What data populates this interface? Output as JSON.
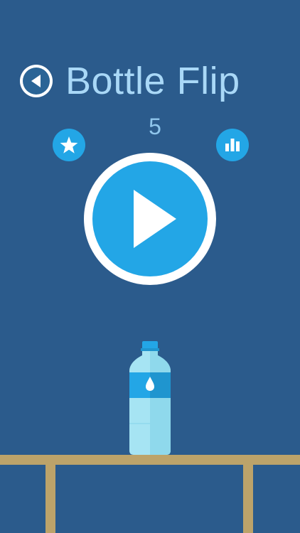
{
  "game": {
    "title": "Bottle Flip",
    "score": "5"
  },
  "buttons": {
    "back_icon": "back-arrow-icon",
    "rate_icon": "star-icon",
    "leaderboard_icon": "bar-chart-icon",
    "play_icon": "play-icon"
  },
  "scene": {
    "bottle_icon": "water-drop-icon",
    "table": "wooden-table"
  },
  "colors": {
    "background": "#2b5b8c",
    "accent": "#23a6e6",
    "title": "#a9d8f7",
    "score": "#8fc6ec",
    "table": "#bca36a",
    "bottle_cap": "#23a6e6",
    "bottle_body": "#a6e4f3"
  }
}
